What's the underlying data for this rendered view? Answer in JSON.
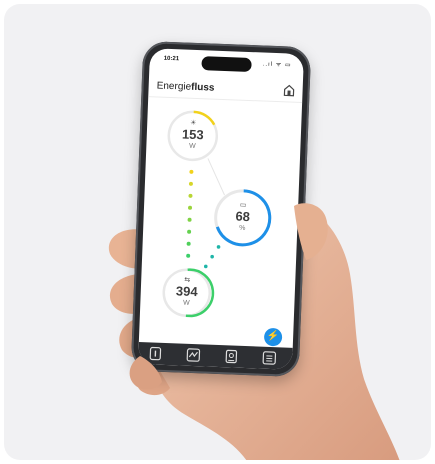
{
  "status_bar": {
    "time": "10:21",
    "icons": "..ıl ᯤ ▭"
  },
  "header": {
    "title_light": "Energie",
    "title_bold": "fluss"
  },
  "nodes": {
    "solar": {
      "icon": "☀",
      "value": "153",
      "unit": "W"
    },
    "battery": {
      "icon": "▭",
      "value": "68",
      "unit": "%"
    },
    "grid": {
      "icon": "⇆",
      "value": "394",
      "unit": "W"
    }
  },
  "fab": {
    "icon": "⚡"
  },
  "tabbar": {
    "tabs": [
      "info-tab",
      "chart-tab",
      "device-tab",
      "menu-tab"
    ]
  },
  "colors": {
    "blue": "#1e90e8",
    "green": "#3ccf6a",
    "yellow": "#f2d21b",
    "teal": "#1fb5a8"
  }
}
